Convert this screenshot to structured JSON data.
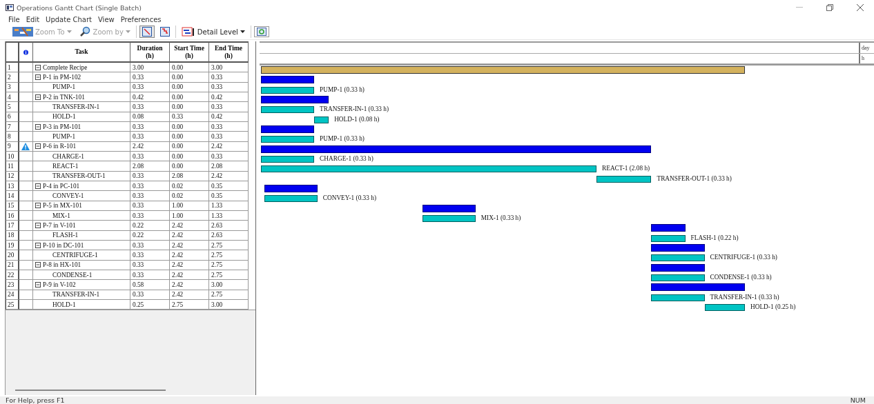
{
  "window": {
    "title": "Operations Gantt Chart (Single Batch)"
  },
  "menu": [
    "File",
    "Edit",
    "Update Chart",
    "View",
    "Preferences"
  ],
  "toolbar": [
    {
      "kind": "icon-menu",
      "label": "Zoom To",
      "disabled": true
    },
    {
      "kind": "search-menu",
      "label": "Zoom by",
      "disabled": true
    },
    {
      "kind": "toggle",
      "pressed": true
    },
    {
      "kind": "toggle",
      "pressed": false
    },
    {
      "kind": "detail-menu",
      "label": "Detail Level",
      "disabled": false
    },
    {
      "kind": "refresh",
      "pressed": false
    }
  ],
  "table": {
    "columns": [
      "Task",
      "Duration (h)",
      "Start Time (h)",
      "End Time (h)"
    ],
    "rows": [
      {
        "number": "1",
        "task": "Complete Recipe",
        "duration": "3.00",
        "start": "0.00",
        "end": "3.00",
        "kind": "recipe",
        "expanded": true,
        "warning": false
      },
      {
        "number": "2",
        "task": "P-1 in PM-102",
        "duration": "0.33",
        "start": "0.00",
        "end": "0.33",
        "kind": "group",
        "expanded": true,
        "warning": false,
        "children": [
          {
            "number": "3",
            "task": "PUMP-1",
            "duration": "0.33",
            "start": "0.00",
            "end": "0.33",
            "kind": "op",
            "bar_label": "PUMP-1 (0.33 h)"
          }
        ]
      },
      {
        "number": "4",
        "task": "P-2 in TNK-101",
        "duration": "0.42",
        "start": "0.00",
        "end": "0.42",
        "kind": "group",
        "expanded": true,
        "warning": false,
        "children": [
          {
            "number": "5",
            "task": "TRANSFER-IN-1",
            "duration": "0.33",
            "start": "0.00",
            "end": "0.33",
            "kind": "op",
            "bar_label": "TRANSFER-IN-1 (0.33 h)"
          },
          {
            "number": "6",
            "task": "HOLD-1",
            "duration": "0.08",
            "start": "0.33",
            "end": "0.42",
            "kind": "op",
            "bar_label": "HOLD-1 (0.08 h)"
          }
        ]
      },
      {
        "number": "7",
        "task": "P-3 in PM-101",
        "duration": "0.33",
        "start": "0.00",
        "end": "0.33",
        "kind": "group",
        "expanded": true,
        "warning": false,
        "children": [
          {
            "number": "8",
            "task": "PUMP-1",
            "duration": "0.33",
            "start": "0.00",
            "end": "0.33",
            "kind": "op",
            "bar_label": "PUMP-1 (0.33 h)"
          }
        ]
      },
      {
        "number": "9",
        "task": "P-6 in R-101",
        "duration": "2.42",
        "start": "0.00",
        "end": "2.42",
        "kind": "group",
        "expanded": true,
        "warning": true,
        "children": [
          {
            "number": "10",
            "task": "CHARGE-1",
            "duration": "0.33",
            "start": "0.00",
            "end": "0.33",
            "kind": "op",
            "bar_label": "CHARGE-1 (0.33 h)"
          },
          {
            "number": "11",
            "task": "REACT-1",
            "duration": "2.08",
            "start": "0.00",
            "end": "2.08",
            "kind": "op",
            "bar_label": "REACT-1 (2.08 h)"
          },
          {
            "number": "12",
            "task": "TRANSFER-OUT-1",
            "duration": "0.33",
            "start": "2.08",
            "end": "2.42",
            "kind": "op",
            "bar_label": "TRANSFER-OUT-1 (0.33 h)"
          }
        ]
      },
      {
        "number": "13",
        "task": "P-4 in PC-101",
        "duration": "0.33",
        "start": "0.02",
        "end": "0.35",
        "kind": "group",
        "expanded": true,
        "warning": false,
        "children": [
          {
            "number": "14",
            "task": "CONVEY-1",
            "duration": "0.33",
            "start": "0.02",
            "end": "0.35",
            "kind": "op",
            "bar_label": "CONVEY-1 (0.33 h)"
          }
        ]
      },
      {
        "number": "15",
        "task": "P-5 in MX-101",
        "duration": "0.33",
        "start": "1.00",
        "end": "1.33",
        "kind": "group",
        "expanded": true,
        "warning": false,
        "children": [
          {
            "number": "16",
            "task": "MIX-1",
            "duration": "0.33",
            "start": "1.00",
            "end": "1.33",
            "kind": "op",
            "bar_label": "MIX-1 (0.33 h)"
          }
        ]
      },
      {
        "number": "17",
        "task": "P-7 in V-101",
        "duration": "0.22",
        "start": "2.42",
        "end": "2.63",
        "kind": "group",
        "expanded": true,
        "warning": false,
        "children": [
          {
            "number": "18",
            "task": "FLASH-1",
            "duration": "0.22",
            "start": "2.42",
            "end": "2.63",
            "kind": "op",
            "bar_label": "FLASH-1 (0.22 h)"
          }
        ]
      },
      {
        "number": "19",
        "task": "P-10 in DC-101",
        "duration": "0.33",
        "start": "2.42",
        "end": "2.75",
        "kind": "group",
        "expanded": true,
        "warning": false,
        "children": [
          {
            "number": "20",
            "task": "CENTRIFUGE-1",
            "duration": "0.33",
            "start": "2.42",
            "end": "2.75",
            "kind": "op",
            "bar_label": "CENTRIFUGE-1 (0.33 h)"
          }
        ]
      },
      {
        "number": "21",
        "task": "P-8 in HX-101",
        "duration": "0.33",
        "start": "2.42",
        "end": "2.75",
        "kind": "group",
        "expanded": true,
        "warning": false,
        "children": [
          {
            "number": "22",
            "task": "CONDENSE-1",
            "duration": "0.33",
            "start": "2.42",
            "end": "2.75",
            "kind": "op",
            "bar_label": "CONDENSE-1 (0.33 h)"
          }
        ]
      },
      {
        "number": "23",
        "task": "P-9 in V-102",
        "duration": "0.58",
        "start": "2.42",
        "end": "3.00",
        "kind": "group",
        "expanded": true,
        "warning": false,
        "children": [
          {
            "number": "24",
            "task": "TRANSFER-IN-1",
            "duration": "0.33",
            "start": "2.42",
            "end": "2.75",
            "kind": "op",
            "bar_label": "TRANSFER-IN-1 (0.33 h)"
          },
          {
            "number": "25",
            "task": "HOLD-1",
            "duration": "0.25",
            "start": "2.75",
            "end": "3.00",
            "kind": "op",
            "bar_label": "HOLD-1 (0.25 h)"
          }
        ]
      }
    ]
  },
  "timeline": {
    "units": [
      "day",
      "h"
    ]
  },
  "status_bar": {
    "message": "For Help, press F1",
    "indicator": "NUM"
  }
}
